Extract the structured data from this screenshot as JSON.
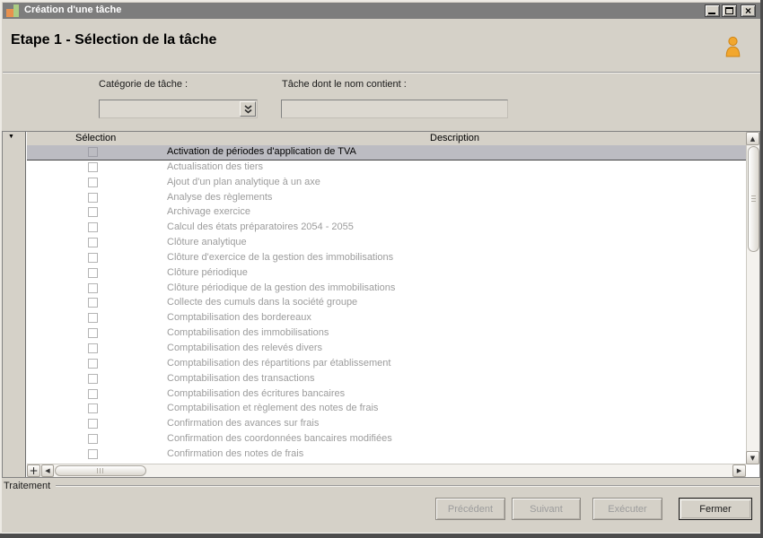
{
  "window": {
    "title": "Création d'une tâche",
    "controls": {
      "minimize": "minimize",
      "maximize": "maximize",
      "close": "×"
    }
  },
  "header": {
    "title": "Etape 1 - Sélection de la tâche"
  },
  "form": {
    "category_label": "Catégorie de tâche :",
    "category_value": "",
    "name_filter_label": "Tâche dont le nom contient :",
    "name_filter_value": ""
  },
  "table": {
    "columns": [
      "Sélection",
      "Description"
    ],
    "rows": [
      {
        "description": "Activation de périodes d'application de TVA",
        "checked": false,
        "selected": true
      },
      {
        "description": "Actualisation des tiers",
        "checked": false,
        "selected": false
      },
      {
        "description": "Ajout d'un plan analytique à un axe",
        "checked": false,
        "selected": false
      },
      {
        "description": "Analyse des règlements",
        "checked": false,
        "selected": false
      },
      {
        "description": "Archivage exercice",
        "checked": false,
        "selected": false
      },
      {
        "description": "Calcul des états préparatoires 2054 - 2055",
        "checked": false,
        "selected": false
      },
      {
        "description": "Clôture analytique",
        "checked": false,
        "selected": false
      },
      {
        "description": "Clôture d'exercice de la gestion des immobilisations",
        "checked": false,
        "selected": false
      },
      {
        "description": "Clôture périodique",
        "checked": false,
        "selected": false
      },
      {
        "description": "Clôture périodique de la gestion des immobilisations",
        "checked": false,
        "selected": false
      },
      {
        "description": "Collecte des cumuls dans la société groupe",
        "checked": false,
        "selected": false
      },
      {
        "description": "Comptabilisation des bordereaux",
        "checked": false,
        "selected": false
      },
      {
        "description": "Comptabilisation des immobilisations",
        "checked": false,
        "selected": false
      },
      {
        "description": "Comptabilisation des relevés divers",
        "checked": false,
        "selected": false
      },
      {
        "description": "Comptabilisation des répartitions par établissement",
        "checked": false,
        "selected": false
      },
      {
        "description": "Comptabilisation des transactions",
        "checked": false,
        "selected": false
      },
      {
        "description": "Comptabilisation des écritures bancaires",
        "checked": false,
        "selected": false
      },
      {
        "description": "Comptabilisation et règlement des notes de frais",
        "checked": false,
        "selected": false
      },
      {
        "description": "Confirmation des avances sur frais",
        "checked": false,
        "selected": false
      },
      {
        "description": "Confirmation des coordonnées bancaires modifiées",
        "checked": false,
        "selected": false
      },
      {
        "description": "Confirmation des notes de frais",
        "checked": false,
        "selected": false
      }
    ]
  },
  "footer": {
    "group_label": "Traitement",
    "buttons": [
      {
        "label": "Précédent",
        "enabled": false
      },
      {
        "label": "Suivant",
        "enabled": false
      },
      {
        "label": "Exécuter",
        "enabled": false
      },
      {
        "label": "Fermer",
        "enabled": true
      }
    ]
  },
  "icons": {
    "row_marker": "▼",
    "scroll_up": "▲",
    "scroll_down": "▼",
    "scroll_left": "◀",
    "scroll_right": "▶",
    "add": "+",
    "close": "×"
  },
  "colors": {
    "titlebar": "#7d7d7d",
    "dialog_bg": "#d5d1c8",
    "selected_row_bg": "#bcbcc2",
    "row_text": "#9c9c9c",
    "accent_orange": "#f2a72e",
    "icon_green": "#abcc83",
    "icon_orange": "#e8914e"
  }
}
